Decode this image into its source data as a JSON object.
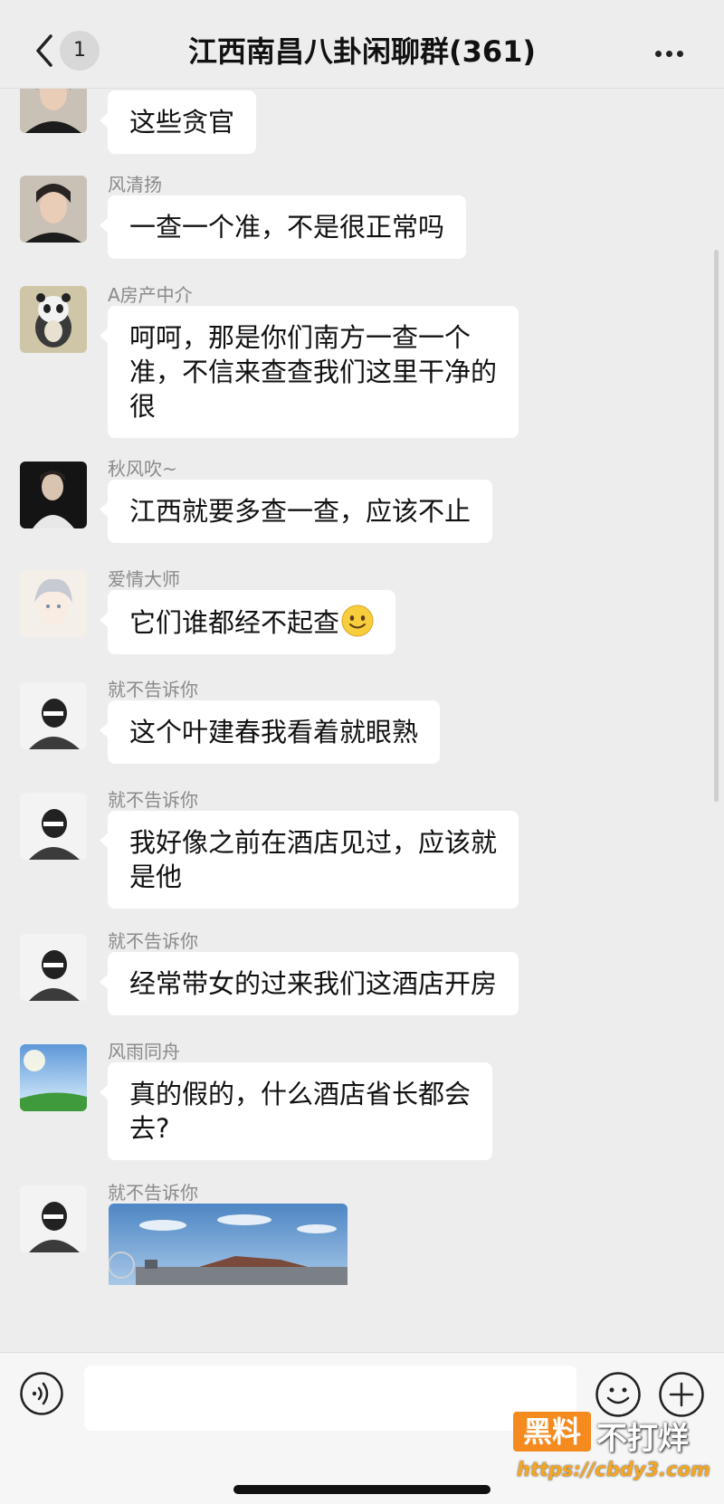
{
  "header": {
    "back_badge": "1",
    "title": "江西南昌八卦闲聊群(361)"
  },
  "messages": [
    {
      "sender": "",
      "text": "这些贪官",
      "avatar": "man-avatar"
    },
    {
      "sender": "风清扬",
      "text": "一查一个准，不是很正常吗",
      "avatar": "man-avatar"
    },
    {
      "sender": "A房产中介",
      "lines": [
        "呵呵，那是你们南方一查一个",
        "准，不信来查查我们这里干净的",
        "很"
      ],
      "avatar": "panda-avatar"
    },
    {
      "sender": "秋风吹~",
      "text": "江西就要多查一查，应该不止",
      "avatar": "man-dark-avatar"
    },
    {
      "sender": "爱情大师",
      "text": "它们谁都经不起查",
      "emoji": "smile-emoji",
      "avatar": "anime-avatar"
    },
    {
      "sender": "就不告诉你",
      "text": "这个叶建春我看着就眼熟",
      "avatar": "masked-avatar"
    },
    {
      "sender": "就不告诉你",
      "lines": [
        "我好像之前在酒店见过，应该就",
        "是他"
      ],
      "avatar": "masked-avatar"
    },
    {
      "sender": "就不告诉你",
      "text": "经常带女的过来我们这酒店开房",
      "avatar": "masked-avatar"
    },
    {
      "sender": "风雨同舟",
      "lines": [
        "真的假的，什么酒店省长都会",
        "去?"
      ],
      "avatar": "sky-avatar"
    },
    {
      "sender": "就不告诉你",
      "image": "city-skyline-photo",
      "avatar": "masked-avatar"
    }
  ],
  "input_bar": {
    "icons": [
      "voice-icon",
      "emoji-icon",
      "plus-icon"
    ],
    "placeholder": ""
  },
  "watermark": {
    "box_text": "黑料",
    "text": "不打烊",
    "url": "https://cbdy3.com"
  },
  "colors": {
    "background": "#ededed",
    "bubble": "#ffffff",
    "sender": "#8a8a8a",
    "watermark_orange": "#f58a1f"
  }
}
